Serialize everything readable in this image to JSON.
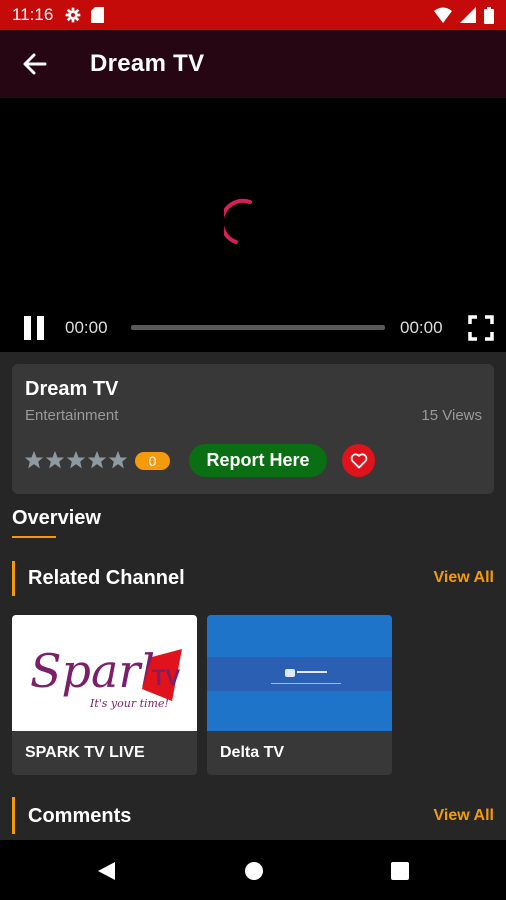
{
  "status_bar": {
    "time": "11:16",
    "bg": "#c50a0a"
  },
  "app_bar": {
    "title": "Dream TV",
    "bg": "#250612",
    "back_icon": "arrow-left-icon"
  },
  "player": {
    "current_time": "00:00",
    "duration": "00:00",
    "progress": 0,
    "state": "loading",
    "accent": "#d81f59"
  },
  "channel_info": {
    "name": "Dream TV",
    "category": "Entertainment",
    "views": "15 Views",
    "rating_count": "0",
    "stars_filled": 0,
    "stars_total": 5,
    "report_label": "Report Here",
    "favorite_icon": "heart-icon"
  },
  "tabs": {
    "overview": "Overview"
  },
  "related": {
    "title": "Related Channel",
    "view_all": "View All",
    "items": [
      {
        "name": "SPARK TV LIVE",
        "logo_text": "Spark",
        "logo_tag": "It's your time!",
        "logo_badge": "TV"
      },
      {
        "name": "Delta TV"
      }
    ]
  },
  "comments": {
    "title": "Comments",
    "view_all": "View All"
  },
  "colors": {
    "accent": "#f59a0c",
    "report_green": "#0a6f12",
    "favorite_red": "#e0121b"
  }
}
